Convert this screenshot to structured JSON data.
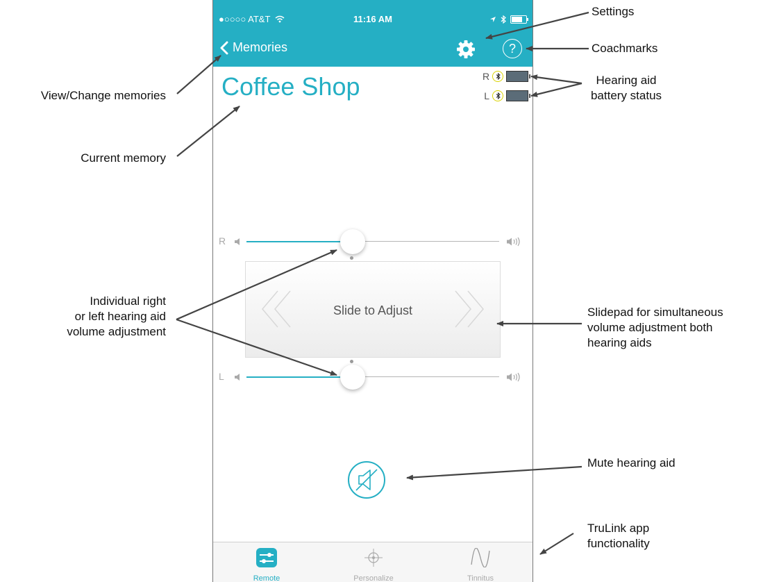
{
  "status_bar": {
    "carrier": "●○○○○ AT&T",
    "time": "11:16 AM"
  },
  "nav": {
    "back_label": "Memories",
    "help_glyph": "?"
  },
  "memory": {
    "name": "Coffee Shop"
  },
  "battery": {
    "right_label": "R",
    "left_label": "L"
  },
  "sliders": [
    {
      "side": "R",
      "value_percent": 42
    },
    {
      "side": "L",
      "value_percent": 42
    }
  ],
  "slidepad": {
    "label": "Slide to Adjust"
  },
  "tabs": [
    {
      "label": "Remote",
      "icon": "remote-sliders-icon",
      "active": true
    },
    {
      "label": "Personalize",
      "icon": "crosshair-icon",
      "active": false
    },
    {
      "label": "Tinnitus",
      "icon": "wave-icon",
      "active": false
    }
  ],
  "annotations": {
    "settings": "Settings",
    "coachmarks": "Coachmarks",
    "hearing_aid_battery": [
      "Hearing aid",
      "battery status"
    ],
    "view_change": "View/Change memories",
    "current_memory": "Current memory",
    "individual": [
      "Individual right",
      "or left hearing aid",
      "volume adjustment"
    ],
    "slidepad": [
      "Slidepad for simultaneous",
      "volume adjustment both",
      "hearing aids"
    ],
    "mute": "Mute hearing aid",
    "trulink": [
      "TruLink app",
      "functionality"
    ]
  },
  "colors": {
    "accent": "#25afc4",
    "bt_ring": "#d9d200",
    "battery": "#5b6c78"
  }
}
